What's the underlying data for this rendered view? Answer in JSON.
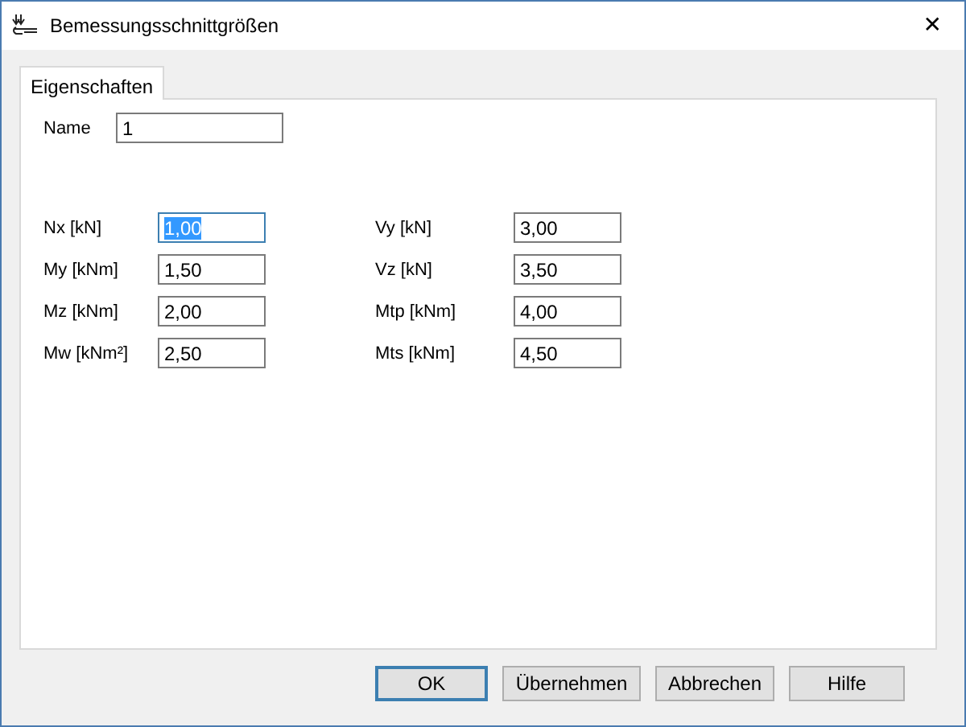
{
  "window": {
    "title": "Bemessungsschnittgrößen",
    "close": "✕"
  },
  "tabs": [
    {
      "label": "Eigenschaften",
      "selected": true
    }
  ],
  "name_field": {
    "label": "Name",
    "value": "1"
  },
  "fields": [
    {
      "label": "Nx [kN]",
      "value": "1,00",
      "focused": true
    },
    {
      "label": "Vy [kN]",
      "value": "3,00",
      "focused": false
    },
    {
      "label": "My [kNm]",
      "value": "1,50",
      "focused": false
    },
    {
      "label": "Vz [kN]",
      "value": "3,50",
      "focused": false
    },
    {
      "label": "Mz [kNm]",
      "value": "2,00",
      "focused": false
    },
    {
      "label": "Mtp [kNm]",
      "value": "4,00",
      "focused": false
    },
    {
      "label": "Mw [kNm²]",
      "value": "2,50",
      "focused": false
    },
    {
      "label": "Mts [kNm]",
      "value": "4,50",
      "focused": false
    }
  ],
  "buttons": [
    {
      "label": "OK",
      "default": true
    },
    {
      "label": "Übernehmen",
      "default": false
    },
    {
      "label": "Abbrechen",
      "default": false
    },
    {
      "label": "Hilfe",
      "default": false
    }
  ]
}
